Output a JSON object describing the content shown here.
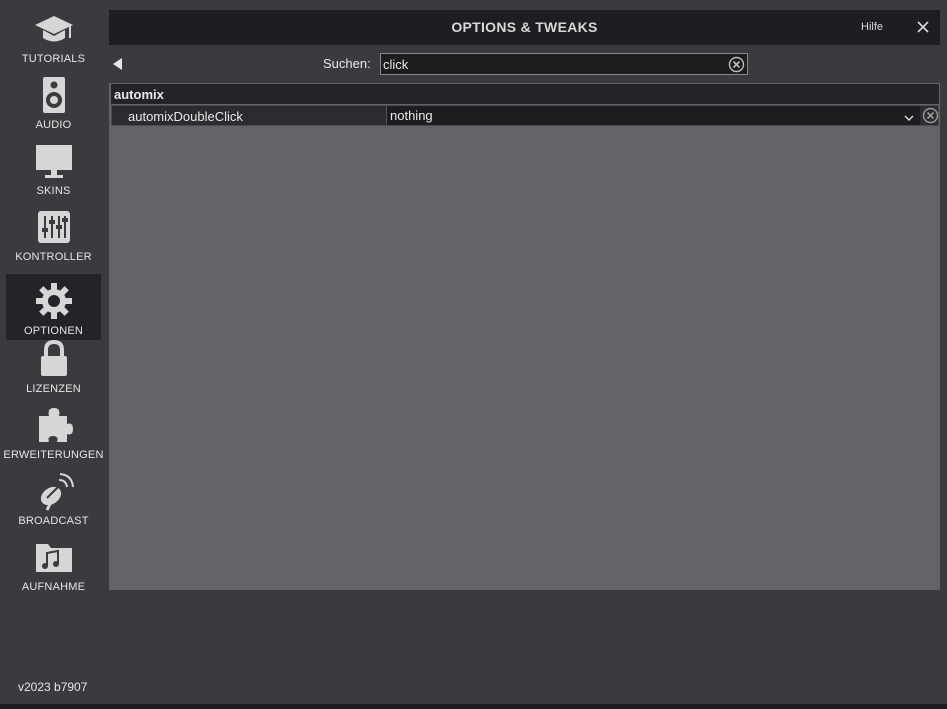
{
  "sidebar": {
    "items": [
      {
        "label": "TUTORIALS",
        "icon": "graduation-cap-icon"
      },
      {
        "label": "AUDIO",
        "icon": "speaker-icon"
      },
      {
        "label": "SKINS",
        "icon": "monitor-icon"
      },
      {
        "label": "KONTROLLER",
        "icon": "mixer-sliders-icon"
      },
      {
        "label": "OPTIONEN",
        "icon": "gear-icon",
        "active": true
      },
      {
        "label": "LIZENZEN",
        "icon": "lock-icon"
      },
      {
        "label": "ERWEITERUNGEN",
        "icon": "puzzle-icon"
      },
      {
        "label": "BROADCAST",
        "icon": "broadcast-icon"
      },
      {
        "label": "AUFNAHME",
        "icon": "music-folder-icon"
      }
    ],
    "version": "v2023 b7907"
  },
  "panel": {
    "title": "OPTIONS & TWEAKS",
    "help_label": "Hilfe",
    "close_icon": "close-icon",
    "back_icon": "back-arrow-icon"
  },
  "search": {
    "label": "Suchen:",
    "value": "click"
  },
  "options": {
    "group_title": "automix",
    "rows": [
      {
        "name": "automixDoubleClick",
        "value": "nothing"
      }
    ]
  },
  "colors": {
    "background": "#3a3b3e",
    "panel_body": "#646468",
    "titlebar": "#1d1e21",
    "active_item": "#232427"
  }
}
